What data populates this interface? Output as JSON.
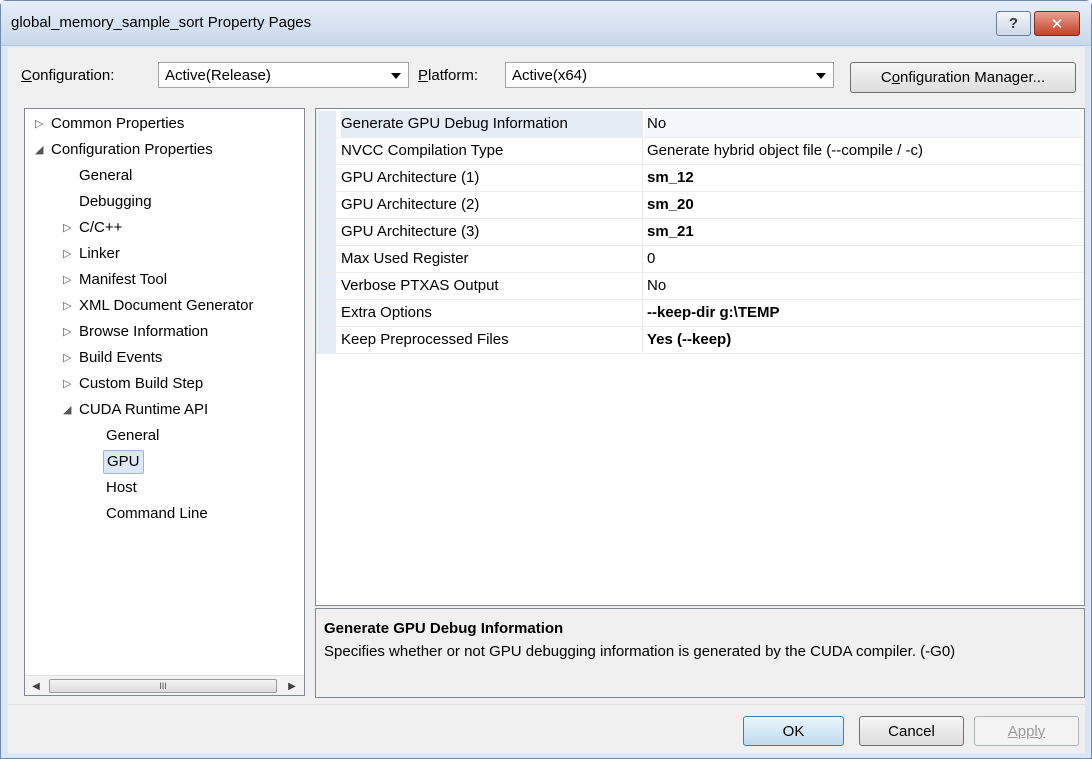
{
  "window": {
    "title": "global_memory_sample_sort Property Pages",
    "help_label": "?",
    "close_label": "✕"
  },
  "toolbar": {
    "configuration_label_pre": "",
    "configuration_label_key": "C",
    "configuration_label_post": "onfiguration:",
    "configuration_value": "Active(Release)",
    "platform_label_key": "P",
    "platform_label_post": "latform:",
    "platform_value": "Active(x64)",
    "config_manager_pre": "C",
    "config_manager_key": "o",
    "config_manager_post": "nfiguration Manager..."
  },
  "tree": {
    "items": [
      {
        "label": "Common Properties",
        "expander": "▷"
      },
      {
        "label": "Configuration Properties",
        "expander": "◢"
      },
      {
        "label": "General",
        "expander": ""
      },
      {
        "label": "Debugging",
        "expander": ""
      },
      {
        "label": "C/C++",
        "expander": "▷"
      },
      {
        "label": "Linker",
        "expander": "▷"
      },
      {
        "label": "Manifest Tool",
        "expander": "▷"
      },
      {
        "label": "XML Document Generator",
        "expander": "▷"
      },
      {
        "label": "Browse Information",
        "expander": "▷"
      },
      {
        "label": "Build Events",
        "expander": "▷"
      },
      {
        "label": "Custom Build Step",
        "expander": "▷"
      },
      {
        "label": "CUDA Runtime API",
        "expander": "◢"
      },
      {
        "label": "General",
        "expander": ""
      },
      {
        "label": "GPU",
        "expander": ""
      },
      {
        "label": "Host",
        "expander": ""
      },
      {
        "label": "Command Line",
        "expander": ""
      }
    ],
    "scroll_left": "◀",
    "scroll_right": "▶",
    "scroll_grip": "III"
  },
  "properties": [
    {
      "name": "Generate GPU Debug Information",
      "value": "No"
    },
    {
      "name": "NVCC Compilation Type",
      "value": "Generate hybrid object file  (--compile / -c)"
    },
    {
      "name": "GPU Architecture (1)",
      "value": "sm_12"
    },
    {
      "name": "GPU Architecture (2)",
      "value": "sm_20"
    },
    {
      "name": "GPU Architecture (3)",
      "value": "sm_21"
    },
    {
      "name": "Max Used Register",
      "value": "0"
    },
    {
      "name": "Verbose PTXAS Output",
      "value": "No"
    },
    {
      "name": "Extra Options",
      "value": "--keep-dir g:\\TEMP"
    },
    {
      "name": "Keep Preprocessed Files",
      "value": "Yes (--keep)"
    }
  ],
  "description": {
    "title": "Generate GPU Debug Information",
    "text": "Specifies whether or not GPU debugging information is generated by the CUDA compiler.  (-G0)"
  },
  "buttons": {
    "ok": "OK",
    "cancel": "Cancel",
    "apply": "Apply"
  }
}
